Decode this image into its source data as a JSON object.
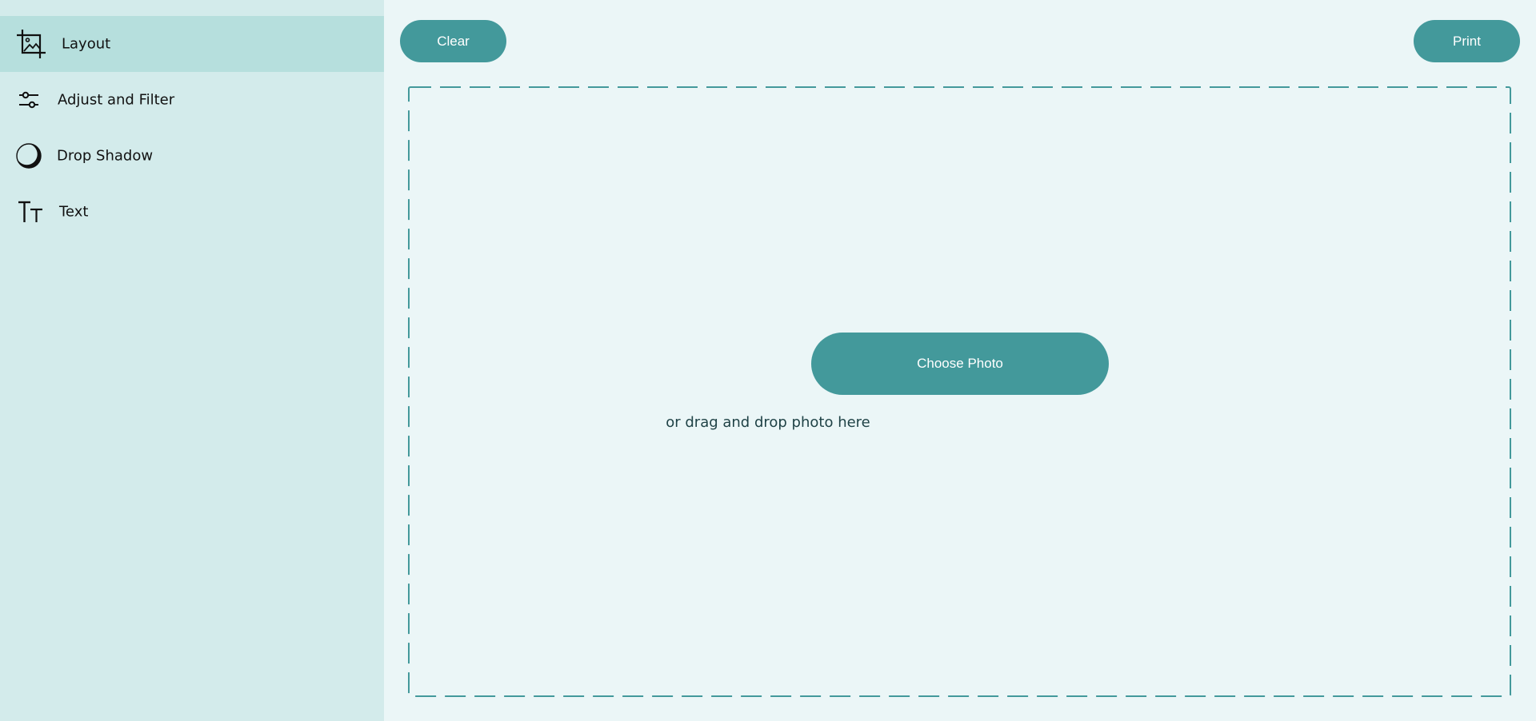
{
  "sidebar": {
    "items": [
      {
        "label": "Layout",
        "icon": "crop-icon",
        "active": true
      },
      {
        "label": "Adjust and Filter",
        "icon": "sliders-icon",
        "active": false
      },
      {
        "label": "Drop Shadow",
        "icon": "shadow-icon",
        "active": false
      },
      {
        "label": "Text",
        "icon": "text-size-icon",
        "active": false
      }
    ]
  },
  "toolbar": {
    "clear_label": "Clear",
    "print_label": "Print"
  },
  "dropzone": {
    "choose_label": "Choose Photo",
    "hint": "or drag and drop photo here"
  },
  "colors": {
    "accent": "#43999b",
    "sidebar_bg": "#d3ebeb",
    "sidebar_active_bg": "#b6dfdd",
    "main_bg": "#ebf6f7"
  }
}
